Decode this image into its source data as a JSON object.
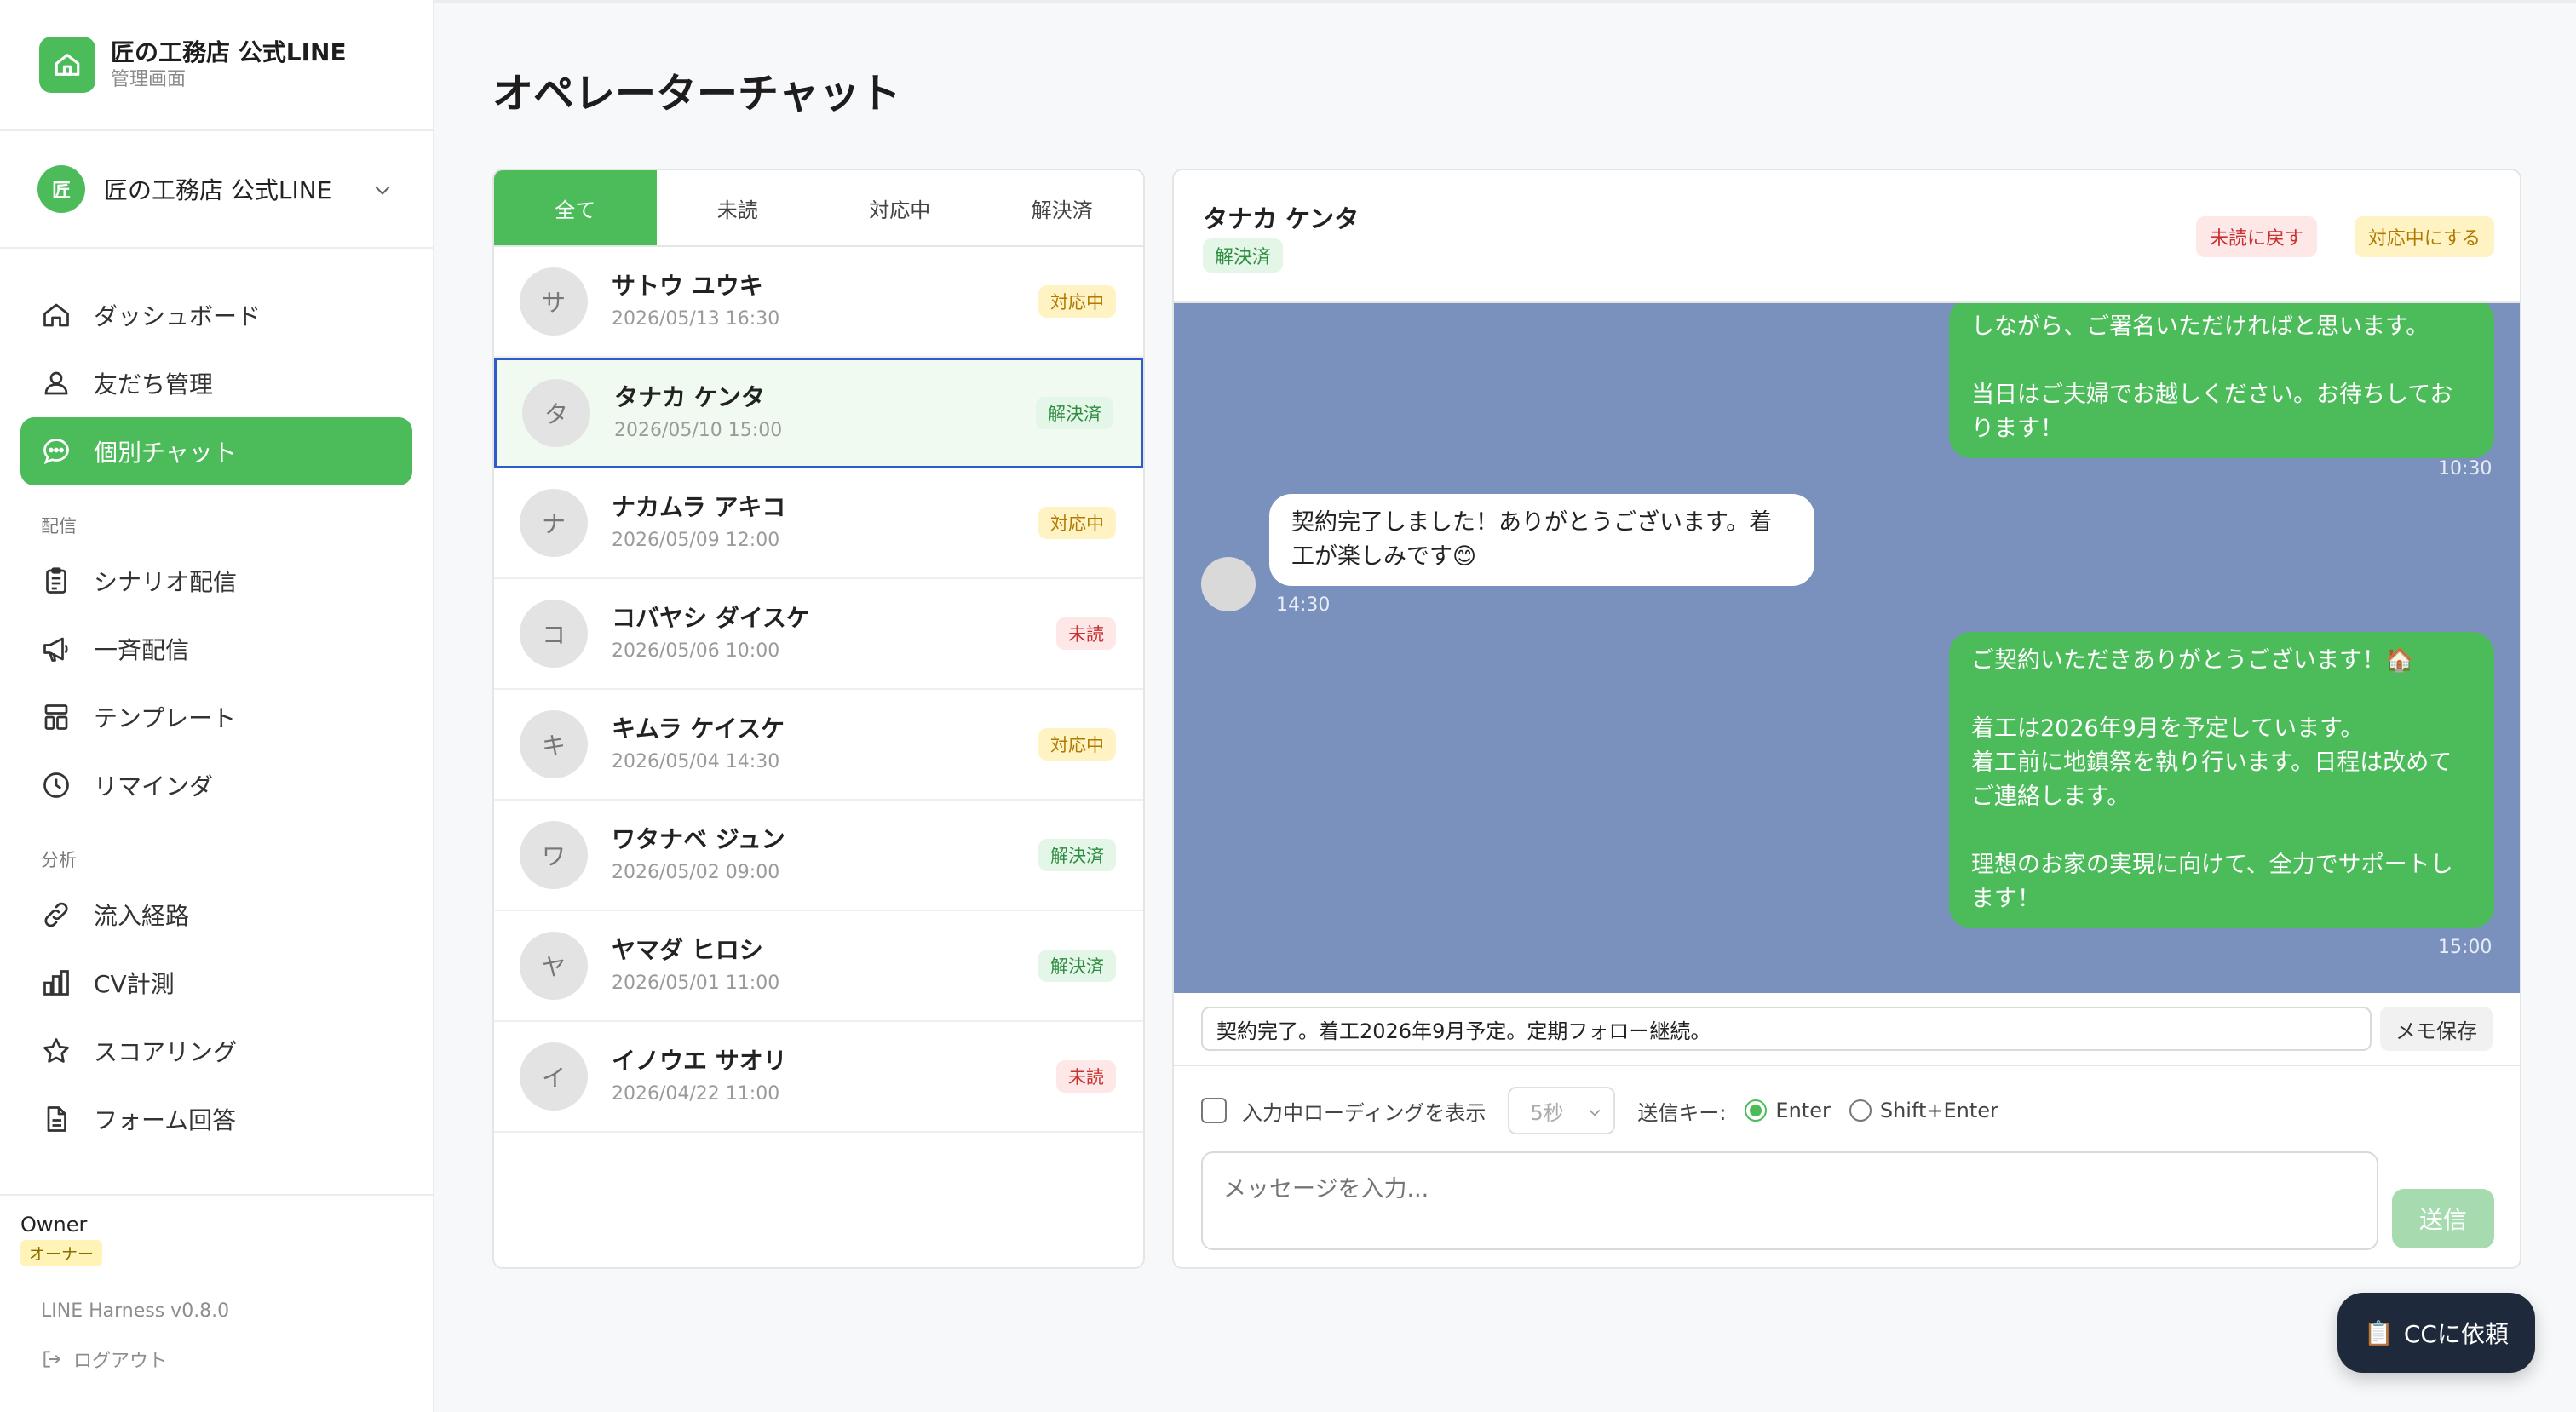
{
  "brand": {
    "title": "匠の工務店 公式LINE",
    "subtitle": "管理画面",
    "icon": "house-icon"
  },
  "account": {
    "avatar_text": "匠",
    "name": "匠の工務店 公式LINE"
  },
  "nav": {
    "main": [
      {
        "label": "ダッシュボード",
        "icon": "home-icon"
      },
      {
        "label": "友だち管理",
        "icon": "users-icon"
      },
      {
        "label": "個別チャット",
        "icon": "chat-icon",
        "active": true
      }
    ],
    "section_delivery": "配信",
    "delivery": [
      {
        "label": "シナリオ配信",
        "icon": "clipboard-icon"
      },
      {
        "label": "一斉配信",
        "icon": "megaphone-icon"
      },
      {
        "label": "テンプレート",
        "icon": "template-icon"
      },
      {
        "label": "リマインダ",
        "icon": "clock-icon"
      }
    ],
    "section_analytics": "分析",
    "analytics": [
      {
        "label": "流入経路",
        "icon": "link-icon"
      },
      {
        "label": "CV計測",
        "icon": "bar-chart-icon"
      },
      {
        "label": "スコアリング",
        "icon": "star-icon"
      },
      {
        "label": "フォーム回答",
        "icon": "document-icon"
      }
    ]
  },
  "user": {
    "name": "Owner",
    "role": "オーナー"
  },
  "version": "LINE Harness v0.8.0",
  "logout": "ログアウト",
  "page_title": "オペレーターチャット",
  "tabs": [
    "全て",
    "未読",
    "対応中",
    "解決済"
  ],
  "conversations": [
    {
      "initial": "サ",
      "name": "サトウ ユウキ",
      "time": "2026/05/13 16:30",
      "status": "対応中",
      "kind": "doing"
    },
    {
      "initial": "タ",
      "name": "タナカ ケンタ",
      "time": "2026/05/10 15:00",
      "status": "解決済",
      "kind": "done",
      "selected": true
    },
    {
      "initial": "ナ",
      "name": "ナカムラ アキコ",
      "time": "2026/05/09 12:00",
      "status": "対応中",
      "kind": "doing"
    },
    {
      "initial": "コ",
      "name": "コバヤシ ダイスケ",
      "time": "2026/05/06 10:00",
      "status": "未読",
      "kind": "unread"
    },
    {
      "initial": "キ",
      "name": "キムラ ケイスケ",
      "time": "2026/05/04 14:30",
      "status": "対応中",
      "kind": "doing"
    },
    {
      "initial": "ワ",
      "name": "ワタナベ ジュン",
      "time": "2026/05/02 09:00",
      "status": "解決済",
      "kind": "done"
    },
    {
      "initial": "ヤ",
      "name": "ヤマダ ヒロシ",
      "time": "2026/05/01 11:00",
      "status": "解決済",
      "kind": "done"
    },
    {
      "initial": "イ",
      "name": "イノウエ サオリ",
      "time": "2026/04/22 11:00",
      "status": "未読",
      "kind": "unread"
    }
  ],
  "chat": {
    "name": "タナカ ケンタ",
    "status": "解決済",
    "btn_unread": "未読に戻す",
    "btn_doing": "対応中にする",
    "messages": [
      {
        "dir": "out",
        "text": "しながら、ご署名いただければと思います。\n\n当日はご夫婦でお越しください。お待ちしてお\nります！",
        "time": "10:30"
      },
      {
        "dir": "in",
        "text": "契約完了しました！ありがとうございます。着\n工が楽しみです😊",
        "time": "14:30"
      },
      {
        "dir": "out",
        "text": "ご契約いただきありがとうございます！🏠\n\n着工は2026年9月を予定しています。\n着工前に地鎮祭を執り行います。日程は改めて\nご連絡します。\n\n理想のお家の実現に向けて、全力でサポートし\nます！",
        "time": "15:00"
      }
    ],
    "memo": "契約完了。着工2026年9月予定。定期フォロー継続。",
    "memo_button": "メモ保存",
    "typing_label": "入力中ローディングを表示",
    "typing_delay": "5秒",
    "send_key_label": "送信キー:",
    "send_key_options": [
      "Enter",
      "Shift+Enter"
    ],
    "send_key_selected": "Enter",
    "composer_placeholder": "メッセージを入力...",
    "send_button": "送信"
  },
  "cc_button": "CCに依頼",
  "colors": {
    "brand_green": "#4cbb5a",
    "chat_bg": "#7b91bd",
    "selected_border": "#2f5cc8"
  }
}
